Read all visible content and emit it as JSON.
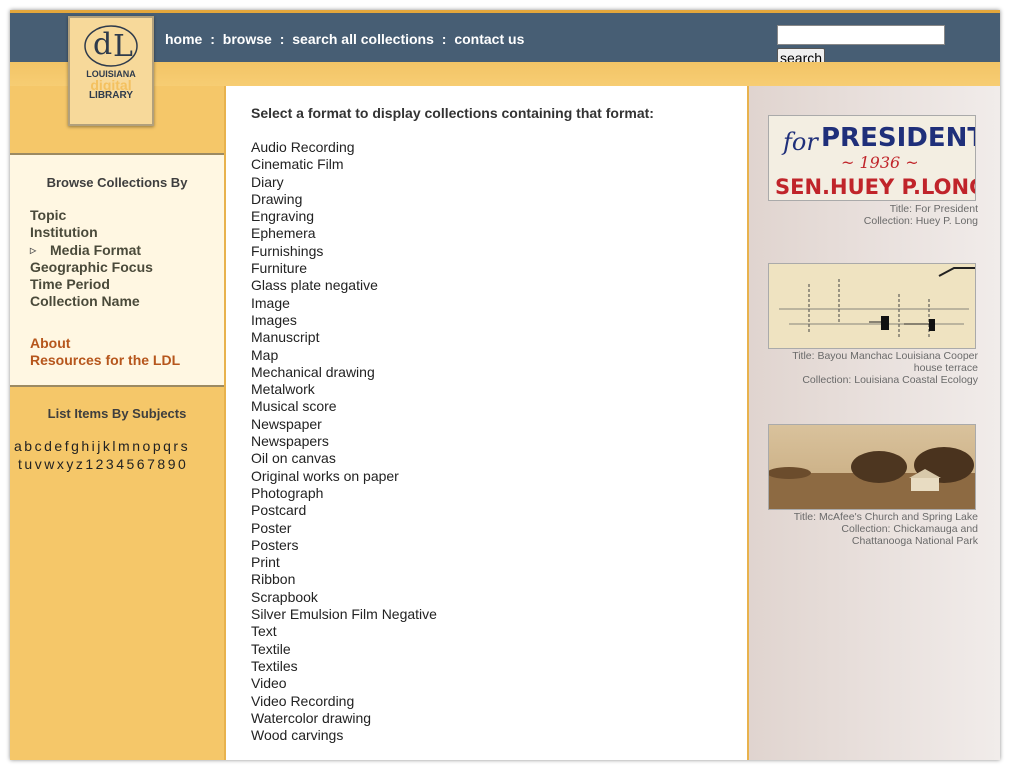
{
  "colors": {
    "topbar": "#475e74",
    "gold": "#f5c769",
    "link_orange": "#b6561c",
    "left_panel": "#fff7e2"
  },
  "logo": {
    "line1": "LOUISIANA",
    "line2": "digital",
    "line3": "LIBRARY"
  },
  "nav": {
    "home": "home",
    "browse": "browse",
    "search_all": "search all collections",
    "contact": "contact us",
    "separator": ":"
  },
  "search": {
    "value": "",
    "button_label": "search"
  },
  "sidebar": {
    "heading": "Browse Collections By",
    "items": [
      {
        "label": "Topic"
      },
      {
        "label": "Institution"
      },
      {
        "label": "Media Format",
        "active": true
      },
      {
        "label": "Geographic Focus"
      },
      {
        "label": "Time Period"
      },
      {
        "label": "Collection Name"
      }
    ],
    "extra_links": [
      {
        "label": "About"
      },
      {
        "label": "Resources for the LDL"
      }
    ]
  },
  "subjects": {
    "heading": "List Items By Subjects",
    "row1": [
      "a",
      "b",
      "c",
      "d",
      "e",
      "f",
      "g",
      "h",
      "i",
      "j",
      "k",
      "l",
      "m",
      "n",
      "o",
      "p",
      "q",
      "r",
      "s"
    ],
    "row2": [
      "t",
      "u",
      "v",
      "w",
      "x",
      "y",
      "z",
      "1",
      "2",
      "3",
      "4",
      "5",
      "6",
      "7",
      "8",
      "9",
      "0"
    ]
  },
  "main": {
    "intro": "Select a format to display collections containing that format:",
    "formats": [
      "Audio Recording",
      "Cinematic Film",
      "Diary",
      "Drawing",
      "Engraving",
      "Ephemera",
      "Furnishings",
      "Furniture",
      "Glass plate negative",
      "Image",
      "Images",
      "Manuscript",
      "Map",
      "Mechanical drawing",
      "Metalwork",
      "Musical score",
      "Newspaper",
      "Newspapers",
      "Oil on canvas",
      "Original works on paper",
      "Photograph",
      "Postcard",
      "Poster",
      "Posters",
      "Print",
      "Ribbon",
      "Scrapbook",
      "Silver Emulsion Film Negative",
      "Text",
      "Textile",
      "Textiles",
      "Video",
      "Video Recording",
      "Watercolor drawing",
      "Wood carvings"
    ]
  },
  "featured": [
    {
      "image_text": {
        "line1a": "for",
        "line1b": "PRESIDENT",
        "line2": "~ 1936 ~",
        "line3": "SEN.HUEY P.LONG"
      },
      "caption_lines": [
        "Title: For President",
        "Collection: Huey P. Long"
      ]
    },
    {
      "caption_lines": [
        "Title: Bayou Manchac Louisiana Cooper",
        "house terrace",
        "Collection: Louisiana Coastal Ecology"
      ]
    },
    {
      "caption_lines": [
        "Title: McAfee's Church and Spring Lake",
        "Collection: Chickamauga and",
        "Chattanooga National Park"
      ]
    }
  ]
}
